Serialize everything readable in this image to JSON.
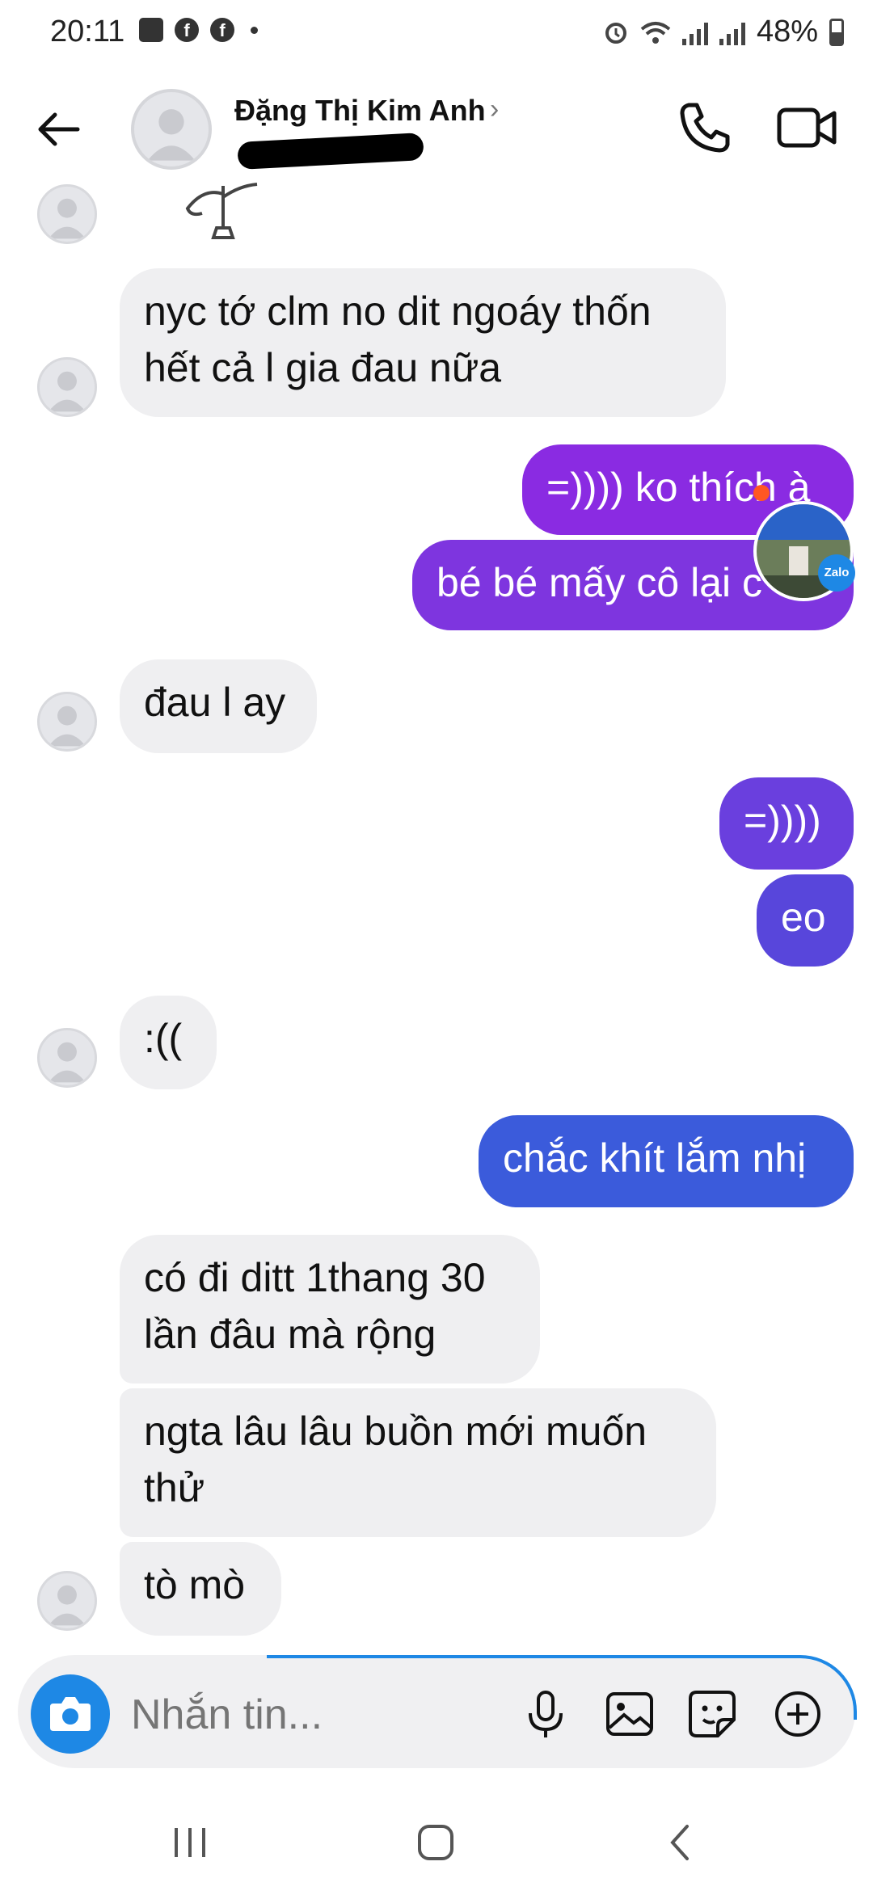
{
  "status_bar": {
    "time": "20:11",
    "battery": "48%"
  },
  "header": {
    "contact_name": "Đặng Thị Kim Anh",
    "chevron": "›"
  },
  "messages": [
    {
      "side": "in",
      "text": "nyc tớ clm no dit ngoáy thốn\nhết cả l gia đau nữa"
    },
    {
      "side": "out",
      "text": "=)))) ko thích à"
    },
    {
      "side": "out",
      "text": "bé bé mấy cô lại c"
    },
    {
      "side": "in",
      "text": "đau l ay"
    },
    {
      "side": "out",
      "text": "=))))"
    },
    {
      "side": "out",
      "text": "eo"
    },
    {
      "side": "in",
      "text": ":(("
    },
    {
      "side": "out",
      "text": "chắc khít lắm nhị"
    },
    {
      "side": "in",
      "text": "có đi ditt 1thang 30\nlần đâu mà rộng"
    },
    {
      "side": "in",
      "text": "ngta lâu lâu buồn mới muốn\nthử"
    },
    {
      "side": "in",
      "text": "tò mò"
    }
  ],
  "floating_bubble": {
    "app_label": "Zalo"
  },
  "composer": {
    "placeholder": "Nhắn tin..."
  },
  "icons": {
    "back": "arrow-left-icon",
    "call": "phone-icon",
    "video": "video-camera-icon",
    "camera": "camera-icon",
    "mic": "microphone-icon",
    "gallery": "image-icon",
    "sticker": "sticker-icon",
    "more": "plus-circle-icon"
  },
  "colors": {
    "incoming_bubble": "#efeff1",
    "outgoing_top": "#8a2be2",
    "outgoing_bottom": "#3b5bdb",
    "accent": "#1e88e5"
  }
}
